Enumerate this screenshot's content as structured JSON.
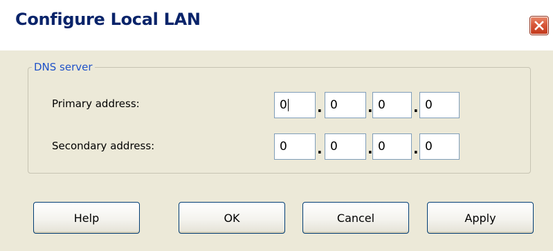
{
  "window": {
    "title": "Configure Local LAN",
    "close_icon": "close-icon"
  },
  "dns_group": {
    "legend": "DNS server",
    "primary": {
      "label": "Primary address:",
      "octets": [
        "0",
        "0",
        "0",
        "0"
      ]
    },
    "secondary": {
      "label": "Secondary address:",
      "octets": [
        "0",
        "0",
        "0",
        "0"
      ]
    },
    "separator": "."
  },
  "buttons": {
    "help": "Help",
    "ok": "OK",
    "cancel": "Cancel",
    "apply": "Apply"
  },
  "colors": {
    "title_text": "#0a246a",
    "legend_text": "#1f52c8",
    "dialog_bg": "#ece9d8",
    "close_button": "#d8573a",
    "button_border": "#003c74",
    "field_border": "#7f9db9"
  }
}
